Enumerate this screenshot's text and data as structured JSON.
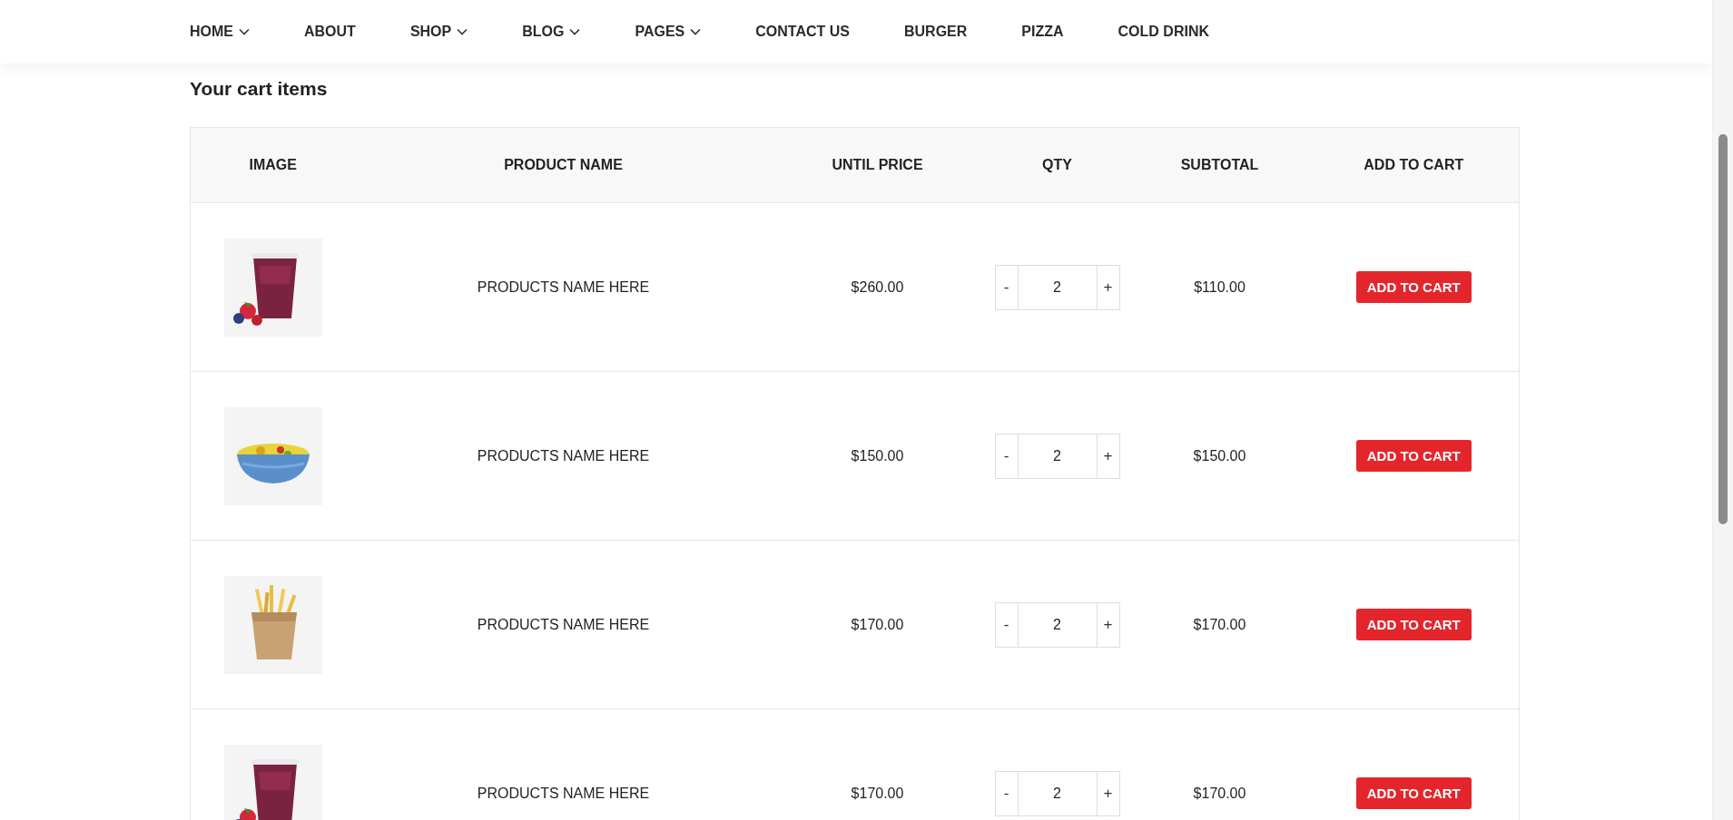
{
  "nav": [
    {
      "label": "HOME",
      "dropdown": true
    },
    {
      "label": "ABOUT",
      "dropdown": false
    },
    {
      "label": "SHOP",
      "dropdown": true
    },
    {
      "label": "BLOG",
      "dropdown": true
    },
    {
      "label": "PAGES",
      "dropdown": true
    },
    {
      "label": "CONTACT US",
      "dropdown": false
    },
    {
      "label": "BURGER",
      "dropdown": false
    },
    {
      "label": "PIZZA",
      "dropdown": false
    },
    {
      "label": "COLD DRINK",
      "dropdown": false
    }
  ],
  "title": "Your cart items",
  "table": {
    "columns": [
      "IMAGE",
      "PRODUCT NAME",
      "UNTIL PRICE",
      "QTY",
      "SUBTOTAL",
      "ADD TO CART"
    ],
    "rows": [
      {
        "name": "PRODUCTS NAME HERE",
        "price": "$260.00",
        "minus": "-",
        "qty": "2",
        "plus": "+",
        "subtotal": "$110.00",
        "button": "ADD TO CART"
      },
      {
        "name": "PRODUCTS NAME HERE",
        "price": "$150.00",
        "minus": "-",
        "qty": "2",
        "plus": "+",
        "subtotal": "$150.00",
        "button": "ADD TO CART"
      },
      {
        "name": "PRODUCTS NAME HERE",
        "price": "$170.00",
        "minus": "-",
        "qty": "2",
        "plus": "+",
        "subtotal": "$170.00",
        "button": "ADD TO CART"
      },
      {
        "name": "PRODUCTS NAME HERE",
        "price": "$170.00",
        "minus": "-",
        "qty": "2",
        "plus": "+",
        "subtotal": "$170.00",
        "button": "ADD TO CART"
      }
    ]
  }
}
